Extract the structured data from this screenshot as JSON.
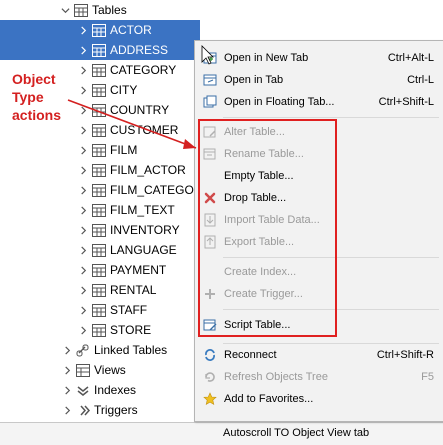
{
  "tree": {
    "tables_label": "Tables",
    "tables": [
      "ACTOR",
      "ADDRESS",
      "CATEGORY",
      "CITY",
      "COUNTRY",
      "CUSTOMER",
      "FILM",
      "FILM_ACTOR",
      "FILM_CATEGO",
      "FILM_TEXT",
      "INVENTORY",
      "LANGUAGE",
      "PAYMENT",
      "RENTAL",
      "STAFF",
      "STORE"
    ],
    "linked_tables": "Linked Tables",
    "views": "Views",
    "indexes": "Indexes",
    "triggers": "Triggers"
  },
  "annotation": {
    "line1": "Object",
    "line2": "Type",
    "line3": "actions",
    "color": "#d42020"
  },
  "menu": {
    "open_new_tab": "Open in New Tab",
    "open_new_tab_sc": "Ctrl+Alt-L",
    "open_tab": "Open in Tab",
    "open_tab_sc": "Ctrl-L",
    "open_floating": "Open in Floating Tab...",
    "open_floating_sc": "Ctrl+Shift-L",
    "alter_table": "Alter Table...",
    "rename_table": "Rename Table...",
    "empty_table": "Empty Table...",
    "drop_table": "Drop Table...",
    "import_table": "Import Table Data...",
    "export_table": "Export Table...",
    "create_index": "Create Index...",
    "create_trigger": "Create Trigger...",
    "script_table": "Script Table...",
    "reconnect": "Reconnect",
    "reconnect_sc": "Ctrl+Shift-R",
    "refresh": "Refresh Objects Tree",
    "refresh_sc": "F5",
    "add_fav": "Add to Favorites...",
    "autoscroll": "Autoscroll TO Object View tab"
  },
  "colors": {
    "selection": "#3b73c3",
    "highlight_box": "#e02020"
  }
}
